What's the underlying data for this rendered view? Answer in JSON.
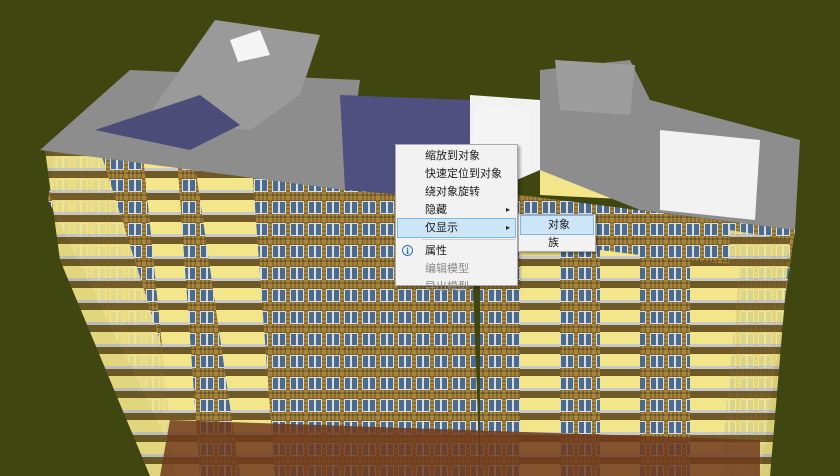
{
  "scene": {
    "background": "#3f4610",
    "wall_color": "#8a6d2c",
    "balcony_color": "#f2e58a",
    "glass_color": "#4b6f8f",
    "roof_color": "#8c8c8c",
    "base_color": "#6e3a1c"
  },
  "context_menu": {
    "items": [
      {
        "label": "缩放到对象",
        "enabled": true
      },
      {
        "label": "快速定位到对象",
        "enabled": true
      },
      {
        "label": "绕对象旋转",
        "enabled": true
      },
      {
        "label": "隐藏",
        "enabled": true,
        "submenu": true
      },
      {
        "label": "仅显示",
        "enabled": true,
        "submenu": true,
        "highlighted": true
      },
      {
        "label": "属性",
        "enabled": true,
        "icon": "info-icon"
      },
      {
        "label": "编辑模型",
        "enabled": false
      },
      {
        "label": "导出模型",
        "enabled": false
      }
    ],
    "submenu_arrow": "▸"
  },
  "submenu": {
    "items": [
      {
        "label": "对象",
        "highlighted": true
      },
      {
        "label": "族"
      }
    ]
  }
}
